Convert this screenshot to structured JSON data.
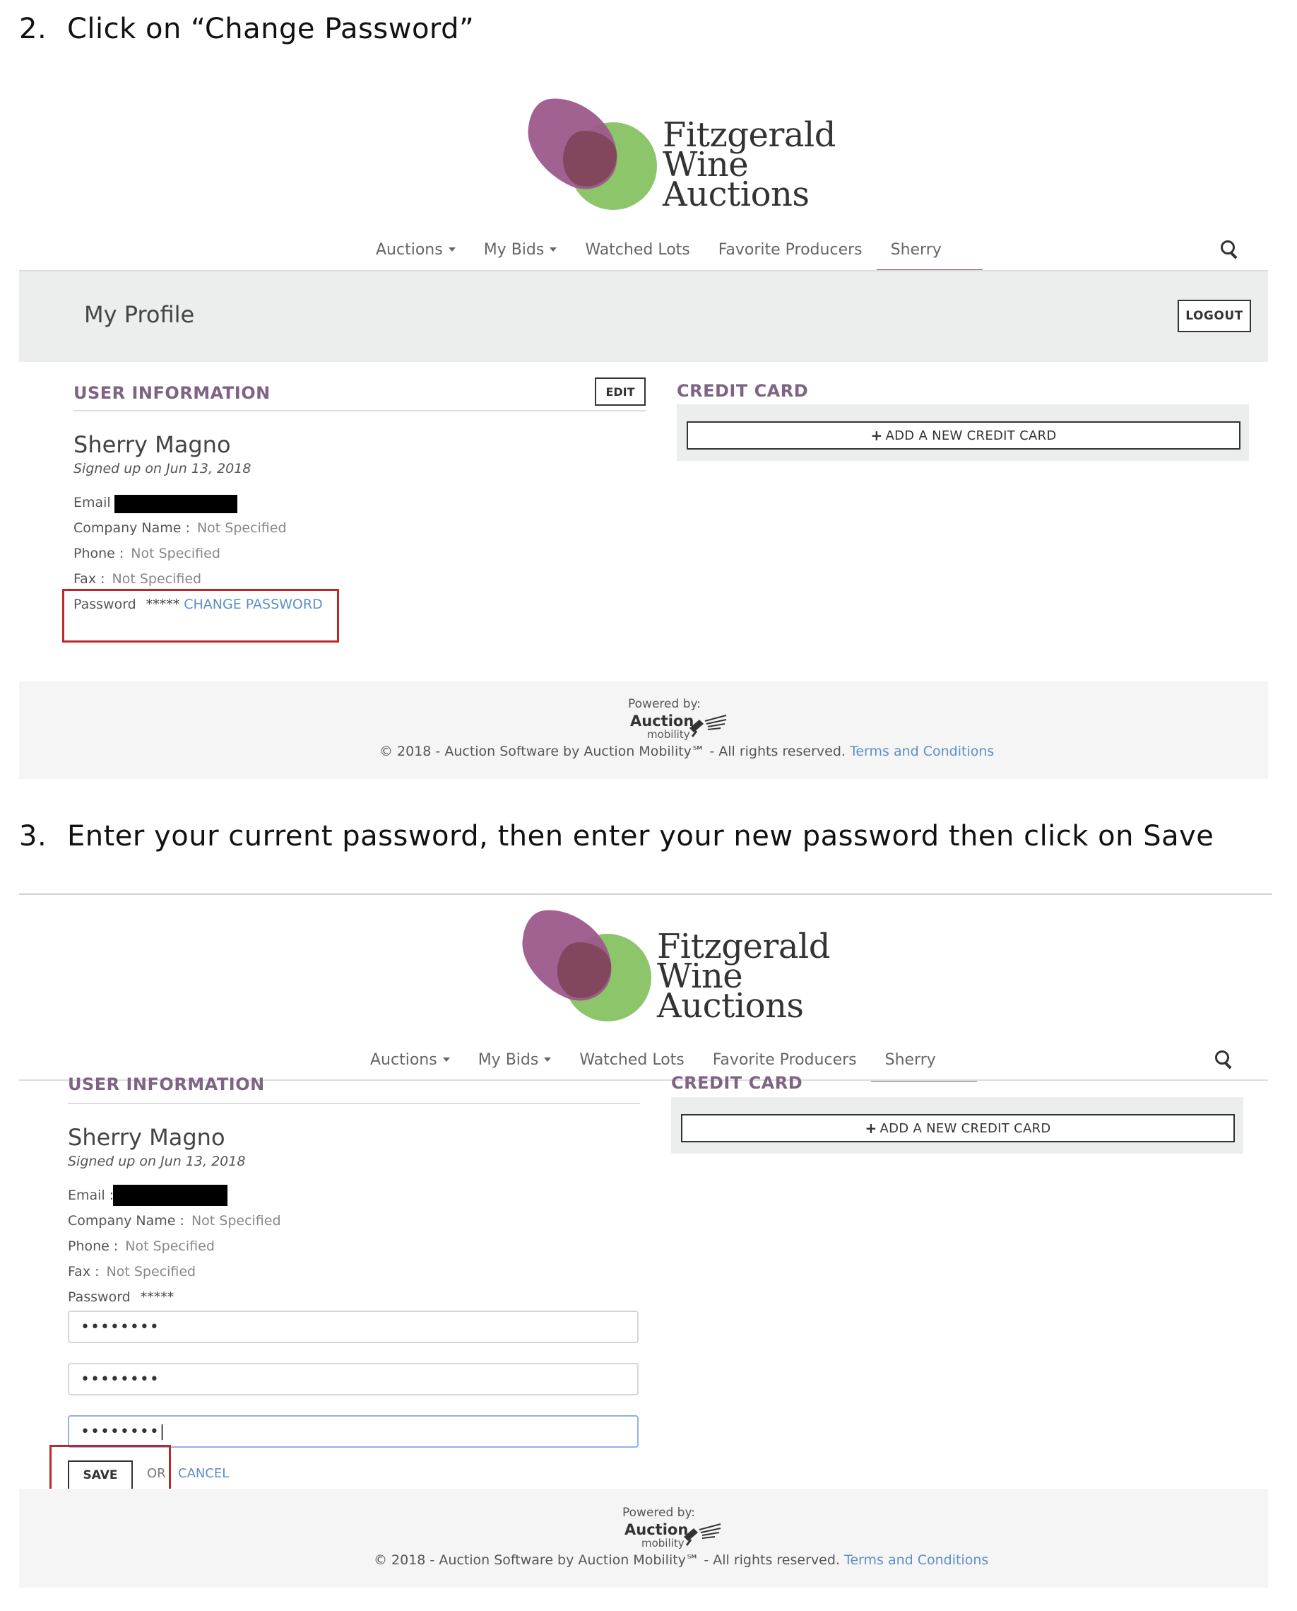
{
  "steps": [
    {
      "number": "2.",
      "text": "Click on “Change Password”"
    },
    {
      "number": "3.",
      "text": "Enter your current password, then enter your new password then click on Save"
    }
  ],
  "brand": {
    "line1": "Fitzgerald",
    "line2": "Wine",
    "line3": "Auctions",
    "colors": {
      "purple": "#9c5a8c",
      "green": "#8cc56a",
      "accent": "#7d6483"
    }
  },
  "nav": {
    "auctions": "Auctions",
    "my_bids": "My Bids",
    "watched_lots": "Watched Lots",
    "favorite_producers": "Favorite Producers",
    "user": "Sherry"
  },
  "profile": {
    "title": "My Profile",
    "logout": "LOGOUT"
  },
  "user_info": {
    "heading": "USER INFORMATION",
    "edit": "EDIT",
    "name": "Sherry Magno",
    "signed_up": "Signed up on Jun 13, 2018",
    "email_label": "Email :",
    "company_label": "Company Name :",
    "company_value": "Not Specified",
    "phone_label": "Phone :",
    "phone_value": "Not Specified",
    "fax_label": "Fax :",
    "fax_value": "Not Specified",
    "password_label": "Password",
    "password_value": "*****",
    "change_password": "CHANGE PASSWORD"
  },
  "credit_card": {
    "heading": "CREDIT CARD",
    "add": "ADD A NEW CREDIT CARD"
  },
  "password_form": {
    "current_value": "••••••••",
    "new_value": "••••••••",
    "confirm_value": "••••••••|",
    "save": "SAVE",
    "or": "OR",
    "cancel": "CANCEL"
  },
  "footer": {
    "powered_by": "Powered by:",
    "am_auction": "Auction",
    "am_mobility": "mobility",
    "copyright": "© 2018 - Auction Software by Auction Mobility℠ - All rights reserved.",
    "terms": "Terms and Conditions"
  }
}
